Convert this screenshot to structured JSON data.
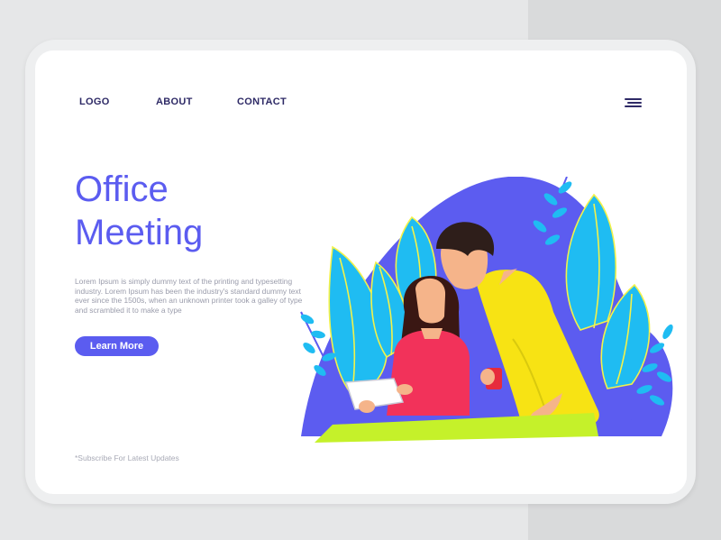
{
  "nav": {
    "logo": "LOGO",
    "about": "ABOUT",
    "contact": "CONTACT",
    "menu_icon": "hamburger-menu-icon"
  },
  "hero": {
    "title_line1": "Office",
    "title_line2": "Meeting",
    "description": "Lorem Ipsum is simply dummy text of the printing and typesetting industry. Lorem Ipsum has been the industry's standard dummy text ever since the 1500s, when an unknown printer took a galley of type and scrambled it to make a type",
    "button_label": "Learn More"
  },
  "footer": {
    "subscribe": "*Subscribe For Latest Updates"
  },
  "colors": {
    "accent": "#5b5cf0",
    "nav_text": "#2e2a66",
    "blob": "#5c5cf0",
    "leaf": "#1fbcf2",
    "table": "#c5f12a",
    "shirt_red": "#f2325a",
    "shirt_yellow": "#f7e314"
  },
  "illustration": {
    "name": "office-meeting-illustration"
  }
}
